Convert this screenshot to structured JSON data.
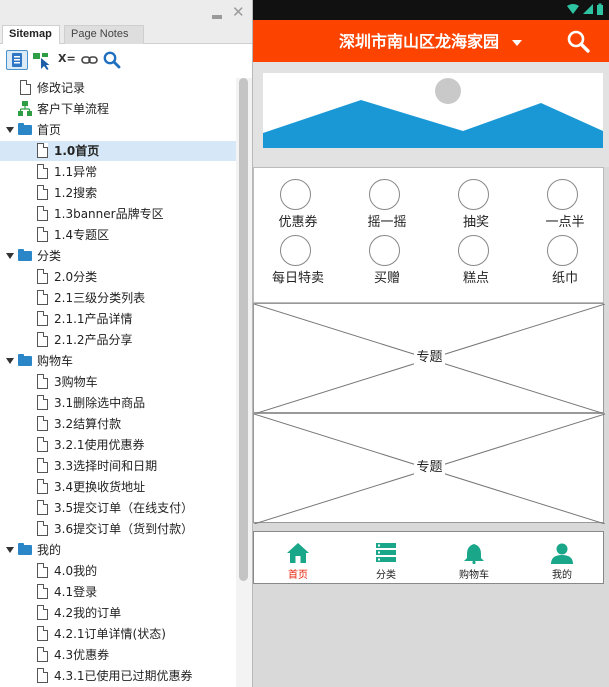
{
  "sitemap_panel": {
    "tabs": [
      {
        "label": "Sitemap",
        "active": true
      },
      {
        "label": "Page Notes",
        "active": false
      }
    ],
    "toolbar": {
      "sort_label": "X="
    },
    "tree": [
      {
        "label": "修改记录",
        "level": 0,
        "kind": "page-plain"
      },
      {
        "label": "客户下单流程",
        "level": 0,
        "kind": "flow"
      },
      {
        "label": "首页",
        "level": 0,
        "kind": "folder"
      },
      {
        "label": "1.0首页",
        "level": 1,
        "kind": "page",
        "selected": true
      },
      {
        "label": "1.1异常",
        "level": 1,
        "kind": "page"
      },
      {
        "label": "1.2搜索",
        "level": 1,
        "kind": "page"
      },
      {
        "label": "1.3banner品牌专区",
        "level": 1,
        "kind": "page"
      },
      {
        "label": "1.4专题区",
        "level": 1,
        "kind": "page"
      },
      {
        "label": "分类",
        "level": 0,
        "kind": "folder"
      },
      {
        "label": "2.0分类",
        "level": 1,
        "kind": "page"
      },
      {
        "label": "2.1三级分类列表",
        "level": 1,
        "kind": "page"
      },
      {
        "label": "2.1.1产品详情",
        "level": 1,
        "kind": "page"
      },
      {
        "label": "2.1.2产品分享",
        "level": 1,
        "kind": "page"
      },
      {
        "label": "购物车",
        "level": 0,
        "kind": "folder"
      },
      {
        "label": "3购物车",
        "level": 1,
        "kind": "page"
      },
      {
        "label": "3.1删除选中商品",
        "level": 1,
        "kind": "page"
      },
      {
        "label": "3.2结算付款",
        "level": 1,
        "kind": "page"
      },
      {
        "label": "3.2.1使用优惠券",
        "level": 1,
        "kind": "page"
      },
      {
        "label": "3.3选择时间和日期",
        "level": 1,
        "kind": "page"
      },
      {
        "label": "3.4更换收货地址",
        "level": 1,
        "kind": "page"
      },
      {
        "label": "3.5提交订单（在线支付）",
        "level": 1,
        "kind": "page"
      },
      {
        "label": "3.6提交订单（货到付款）",
        "level": 1,
        "kind": "page"
      },
      {
        "label": "我的",
        "level": 0,
        "kind": "folder"
      },
      {
        "label": "4.0我的",
        "level": 1,
        "kind": "page"
      },
      {
        "label": "4.1登录",
        "level": 1,
        "kind": "page"
      },
      {
        "label": "4.2我的订单",
        "level": 1,
        "kind": "page"
      },
      {
        "label": "4.2.1订单详情(状态)",
        "level": 1,
        "kind": "page"
      },
      {
        "label": "4.3优惠券",
        "level": 1,
        "kind": "page"
      },
      {
        "label": "4.3.1已使用已过期优惠券",
        "level": 1,
        "kind": "page"
      }
    ]
  },
  "prototype": {
    "header_title": "深圳市南山区龙海家园",
    "theme_color": "#fc4300",
    "nav_active_color": "#e8230a",
    "icon_color": "#19a689",
    "categories": [
      "优惠券",
      "摇一摇",
      "抽奖",
      "一点半",
      "每日特卖",
      "买赠",
      "糕点",
      "纸巾"
    ],
    "special_sections": [
      "专题",
      "专题"
    ],
    "bottom_nav": [
      {
        "label": "首页",
        "icon": "home-icon",
        "active": true
      },
      {
        "label": "分类",
        "icon": "list-icon",
        "active": false
      },
      {
        "label": "购物车",
        "icon": "bell-icon",
        "active": false
      },
      {
        "label": "我的",
        "icon": "user-icon",
        "active": false
      }
    ]
  }
}
